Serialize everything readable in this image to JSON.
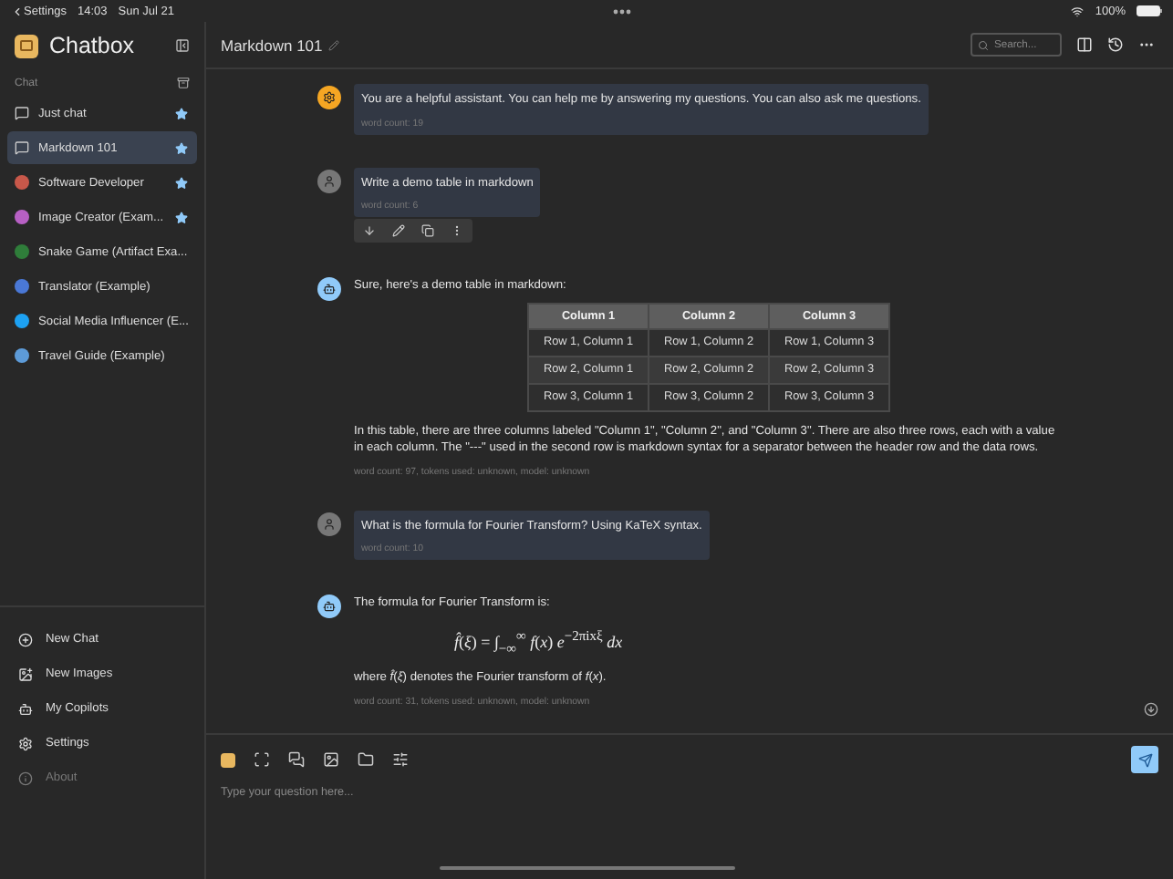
{
  "status_bar": {
    "back_label": "Settings",
    "time": "14:03",
    "date": "Sun Jul 21",
    "battery": "100%"
  },
  "sidebar": {
    "app_name": "Chatbox",
    "section_label": "Chat",
    "items": [
      {
        "label": "Just chat",
        "kind": "chat",
        "starred": true,
        "selected": false
      },
      {
        "label": "Markdown 101",
        "kind": "chat",
        "starred": true,
        "selected": true
      },
      {
        "label": "Software Developer",
        "kind": "avatar",
        "color": "#c8584a",
        "starred": true,
        "selected": false
      },
      {
        "label": "Image Creator (Exam...",
        "kind": "avatar",
        "color": "#b760c4",
        "starred": true,
        "selected": false
      },
      {
        "label": "Snake Game (Artifact Exa...",
        "kind": "avatar",
        "color": "#2f7d3a",
        "starred": false,
        "selected": false
      },
      {
        "label": "Translator (Example)",
        "kind": "avatar",
        "color": "#4a78d6",
        "starred": false,
        "selected": false
      },
      {
        "label": "Social Media Influencer (E...",
        "kind": "avatar",
        "color": "#1da1f2",
        "starred": false,
        "selected": false
      },
      {
        "label": "Travel Guide (Example)",
        "kind": "avatar",
        "color": "#5d9bd8",
        "starred": false,
        "selected": false
      }
    ],
    "footer": [
      {
        "label": "New Chat",
        "kind": "new_chat",
        "disabled": false
      },
      {
        "label": "New Images",
        "kind": "new_images",
        "disabled": false
      },
      {
        "label": "My Copilots",
        "kind": "copilots",
        "disabled": false
      },
      {
        "label": "Settings",
        "kind": "settings",
        "disabled": false
      },
      {
        "label": "About",
        "kind": "about",
        "disabled": true
      }
    ]
  },
  "header": {
    "title": "Markdown 101",
    "search": {
      "placeholder": "Search..."
    }
  },
  "messages": [
    {
      "kind": "system",
      "blocks": [
        {
          "kind": "text",
          "text": "You are a helpful assistant. You can help me by answering my questions. You can also ask me questions."
        }
      ],
      "meta": "word count: 19",
      "actions": false
    },
    {
      "kind": "user",
      "blocks": [
        {
          "kind": "text",
          "text": "Write a demo table in markdown"
        }
      ],
      "meta": "word count: 6",
      "actions": true
    },
    {
      "kind": "assistant",
      "blocks": [
        {
          "kind": "text",
          "text": "Sure, here's a demo table in markdown:"
        },
        {
          "kind": "table",
          "columns": [
            "Column 1",
            "Column 2",
            "Column 3"
          ],
          "rows": [
            [
              "Row 1, Column 1",
              "Row 1, Column 2",
              "Row 1, Column 3"
            ],
            [
              "Row 2, Column 1",
              "Row 2, Column 2",
              "Row 2, Column 3"
            ],
            [
              "Row 3, Column 1",
              "Row 3, Column 2",
              "Row 3, Column 3"
            ]
          ]
        },
        {
          "kind": "text",
          "text": "In this table, there are three columns labeled \"Column 1\", \"Column 2\", and \"Column 3\". There are also three rows, each with a value in each column. The \"---\" used in the second row is markdown syntax for a separator between the header row and the data rows."
        }
      ],
      "meta": "word count: 97, tokens used: unknown, model: unknown",
      "actions": false
    },
    {
      "kind": "user",
      "blocks": [
        {
          "kind": "text",
          "text": "What is the formula for Fourier Transform? Using KaTeX syntax."
        }
      ],
      "meta": "word count: 10",
      "actions": false
    },
    {
      "kind": "assistant",
      "blocks": [
        {
          "kind": "text",
          "text": "The formula for Fourier Transform is:"
        },
        {
          "kind": "formula",
          "text": "*f̂*(*ξ*) = ∫$_{−∞}$$^{∞}$ *f*(*x*) *e*$^{−2πixξ}$ *dx*"
        },
        {
          "kind": "text",
          "text": "where *f̂*(*ξ*) denotes the Fourier transform of *f*(*x*)."
        }
      ],
      "meta": "word count: 31, tokens used: unknown, model: unknown",
      "actions": false
    }
  ],
  "composer": {
    "placeholder": "Type your question here..."
  }
}
